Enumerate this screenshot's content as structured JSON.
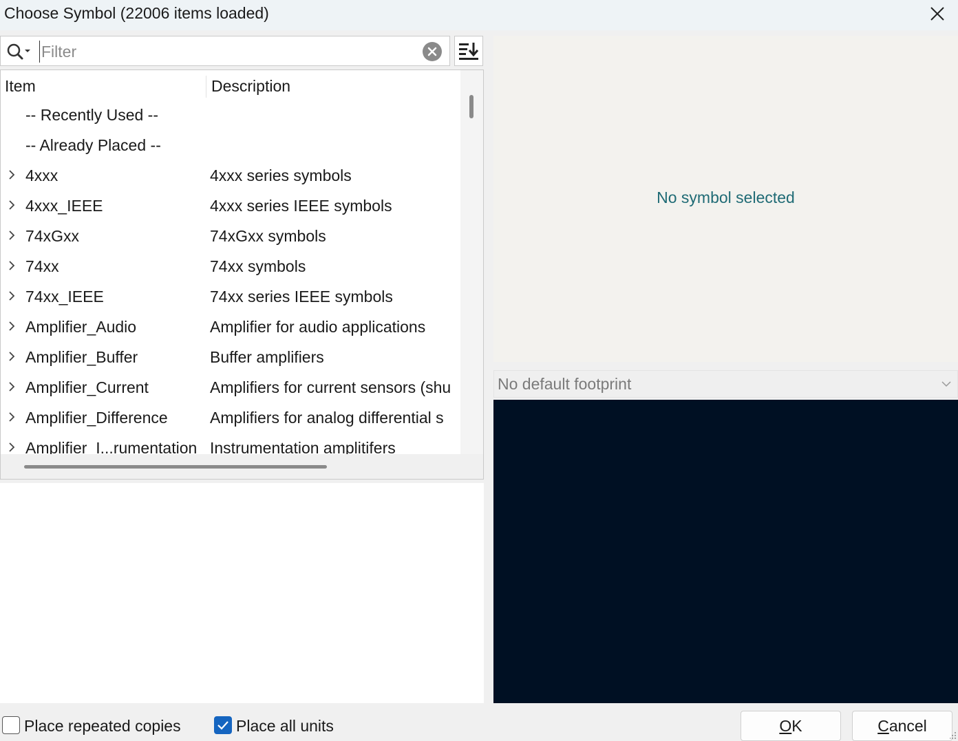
{
  "window": {
    "title": "Choose Symbol (22006 items loaded)"
  },
  "filter": {
    "placeholder": "Filter",
    "value": ""
  },
  "tree": {
    "headers": {
      "item": "Item",
      "description": "Description"
    },
    "rows": [
      {
        "name": "-- Recently Used --",
        "description": "",
        "expandable": false
      },
      {
        "name": "-- Already Placed --",
        "description": "",
        "expandable": false
      },
      {
        "name": "4xxx",
        "description": "4xxx series symbols",
        "expandable": true
      },
      {
        "name": "4xxx_IEEE",
        "description": "4xxx series IEEE symbols",
        "expandable": true
      },
      {
        "name": "74xGxx",
        "description": "74xGxx symbols",
        "expandable": true
      },
      {
        "name": "74xx",
        "description": "74xx symbols",
        "expandable": true
      },
      {
        "name": "74xx_IEEE",
        "description": "74xx series IEEE symbols",
        "expandable": true
      },
      {
        "name": "Amplifier_Audio",
        "description": "Amplifier for audio applications",
        "expandable": true
      },
      {
        "name": "Amplifier_Buffer",
        "description": "Buffer amplifiers",
        "expandable": true
      },
      {
        "name": "Amplifier_Current",
        "description": "Amplifiers for current sensors (shu",
        "expandable": true
      },
      {
        "name": "Amplifier_Difference",
        "description": "Amplifiers for analog differential s",
        "expandable": true
      },
      {
        "name": "Amplifier_I...rumentation",
        "description": "Instrumentation amplitifers",
        "expandable": true
      }
    ]
  },
  "preview": {
    "message": "No symbol selected"
  },
  "footprint": {
    "selected": "No default footprint"
  },
  "options": {
    "repeated": {
      "label": "Place repeated copies",
      "checked": false
    },
    "all_units": {
      "label": "Place all units",
      "checked": true
    }
  },
  "buttons": {
    "ok": {
      "mnemonic": "O",
      "rest": "K"
    },
    "cancel": {
      "mnemonic": "C",
      "rest": "ancel"
    }
  },
  "colors": {
    "accent": "#1565c0",
    "preview_bg": "#001023",
    "message": "#1f6b75"
  }
}
